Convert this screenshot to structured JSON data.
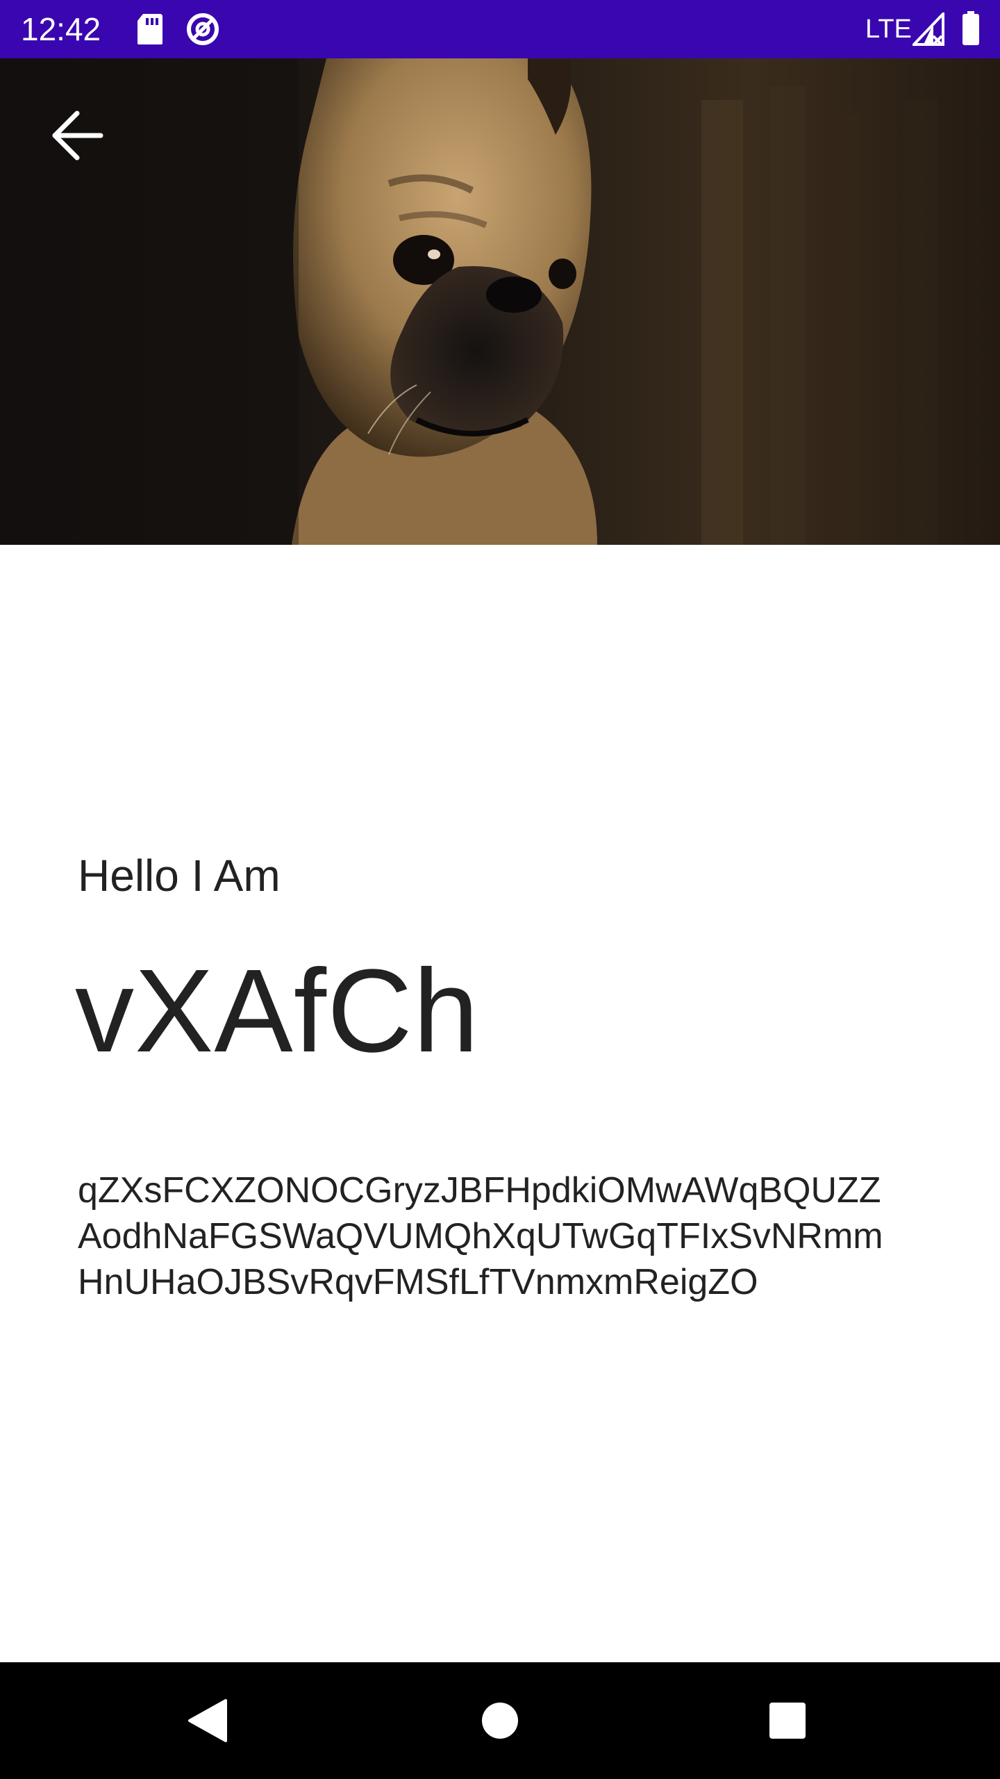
{
  "status_bar": {
    "time": "12:42",
    "network": "LTE",
    "icons": [
      "sd-card-icon",
      "data-saver-icon",
      "signal-icon",
      "battery-icon"
    ],
    "background_color": "#3a06b0"
  },
  "header": {
    "image_subject": "pug-photo",
    "back_icon": "arrow-back-icon"
  },
  "profile": {
    "greeting": "Hello I Am",
    "name": "vXAfCh",
    "bio_lines": [
      "qZXsFCXZONOCGryzJBFHpdkiOMwAWqBQUZZ",
      "AodhNaFGSWaQVUMQhXqUTwGqTFIxSvNRmm",
      "HnUHaOJBSvRqvFMSfLfTVnmxmReigZO"
    ]
  },
  "nav_bar": {
    "buttons": [
      "back-nav-icon",
      "home-nav-icon",
      "recents-nav-icon"
    ]
  }
}
